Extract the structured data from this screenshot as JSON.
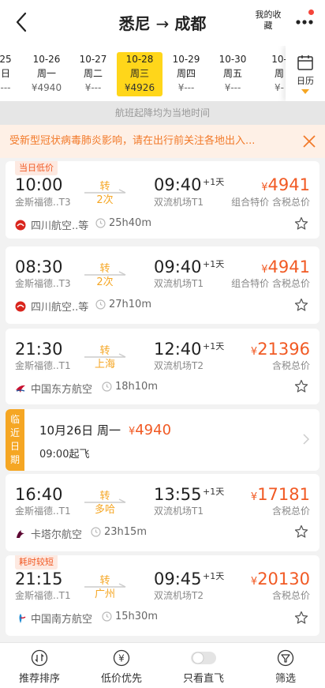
{
  "header": {
    "title_from": "悉尼",
    "title_arrow": "→",
    "title_to": "成都",
    "favorite_label": "我的收藏"
  },
  "dates": [
    {
      "date": "25",
      "weekday": "日",
      "price": "---"
    },
    {
      "date": "10-26",
      "weekday": "周一",
      "price": "¥4940"
    },
    {
      "date": "10-27",
      "weekday": "周二",
      "price": "¥---"
    },
    {
      "date": "10-28",
      "weekday": "周三",
      "price": "¥4926"
    },
    {
      "date": "10-29",
      "weekday": "周四",
      "price": "¥---"
    },
    {
      "date": "10-30",
      "weekday": "周五",
      "price": "¥---"
    },
    {
      "date": "10-",
      "weekday": "周",
      "price": "¥-"
    }
  ],
  "calendar_label": "日历",
  "timezone_note": "航班起降均为当地时间",
  "notice_text": "受新型冠状病毒肺炎影响，请在出行前关注各地出入...",
  "flights": [
    {
      "tag": "当日低价",
      "dep_time": "10:00",
      "dep_airport": "金斯福德..T3",
      "transfer_label": "转",
      "transfer_detail": "2次",
      "arr_time": "09:40",
      "plus_day": "+1天",
      "arr_airport": "双流机场T1",
      "currency": "¥",
      "price": "4941",
      "price_note": "组合特价 含税总价",
      "airline": "四川航空..等",
      "duration": "25h40m"
    },
    {
      "dep_time": "08:30",
      "dep_airport": "金斯福德..T3",
      "transfer_label": "转",
      "transfer_detail": "2次",
      "arr_time": "09:40",
      "plus_day": "+1天",
      "arr_airport": "双流机场T1",
      "currency": "¥",
      "price": "4941",
      "price_note": "组合特价 含税总价",
      "airline": "四川航空..等",
      "duration": "27h10m"
    },
    {
      "dep_time": "21:30",
      "dep_airport": "金斯福德..T1",
      "transfer_label": "转",
      "transfer_detail": "上海",
      "arr_time": "12:40",
      "plus_day": "+1天",
      "arr_airport": "双流机场T2",
      "currency": "¥",
      "price": "21396",
      "price_note": "含税总价",
      "airline": "中国东方航空",
      "duration": "18h10m"
    },
    {
      "dep_time": "16:40",
      "dep_airport": "金斯福德..T1",
      "transfer_label": "转",
      "transfer_detail": "多哈",
      "arr_time": "13:55",
      "plus_day": "+1天",
      "arr_airport": "双流机场T1",
      "currency": "¥",
      "price": "17181",
      "price_note": "含税总价",
      "airline": "卡塔尔航空",
      "duration": "23h15m"
    },
    {
      "tag": "耗时较短",
      "dep_time": "21:15",
      "dep_airport": "金斯福德..T1",
      "transfer_label": "转",
      "transfer_detail": "广州",
      "arr_time": "09:45",
      "plus_day": "+1天",
      "arr_airport": "双流机场T2",
      "currency": "¥",
      "price": "20130",
      "price_note": "含税总价",
      "airline": "中国南方航空",
      "duration": "15h30m"
    }
  ],
  "nearby": {
    "tag_label": "临近日期",
    "date": "10月26日 周一",
    "currency": "¥",
    "price": "4940",
    "departure": "09:00起飞"
  },
  "bottom_bar": {
    "sort": "推荐排序",
    "low_price": "低价优先",
    "direct_only": "只看直飞",
    "filter": "筛选"
  },
  "colors": {
    "accent_orange": "#f15a24",
    "highlight_yellow": "#ffd61a",
    "transfer_orange": "#f5a623"
  }
}
